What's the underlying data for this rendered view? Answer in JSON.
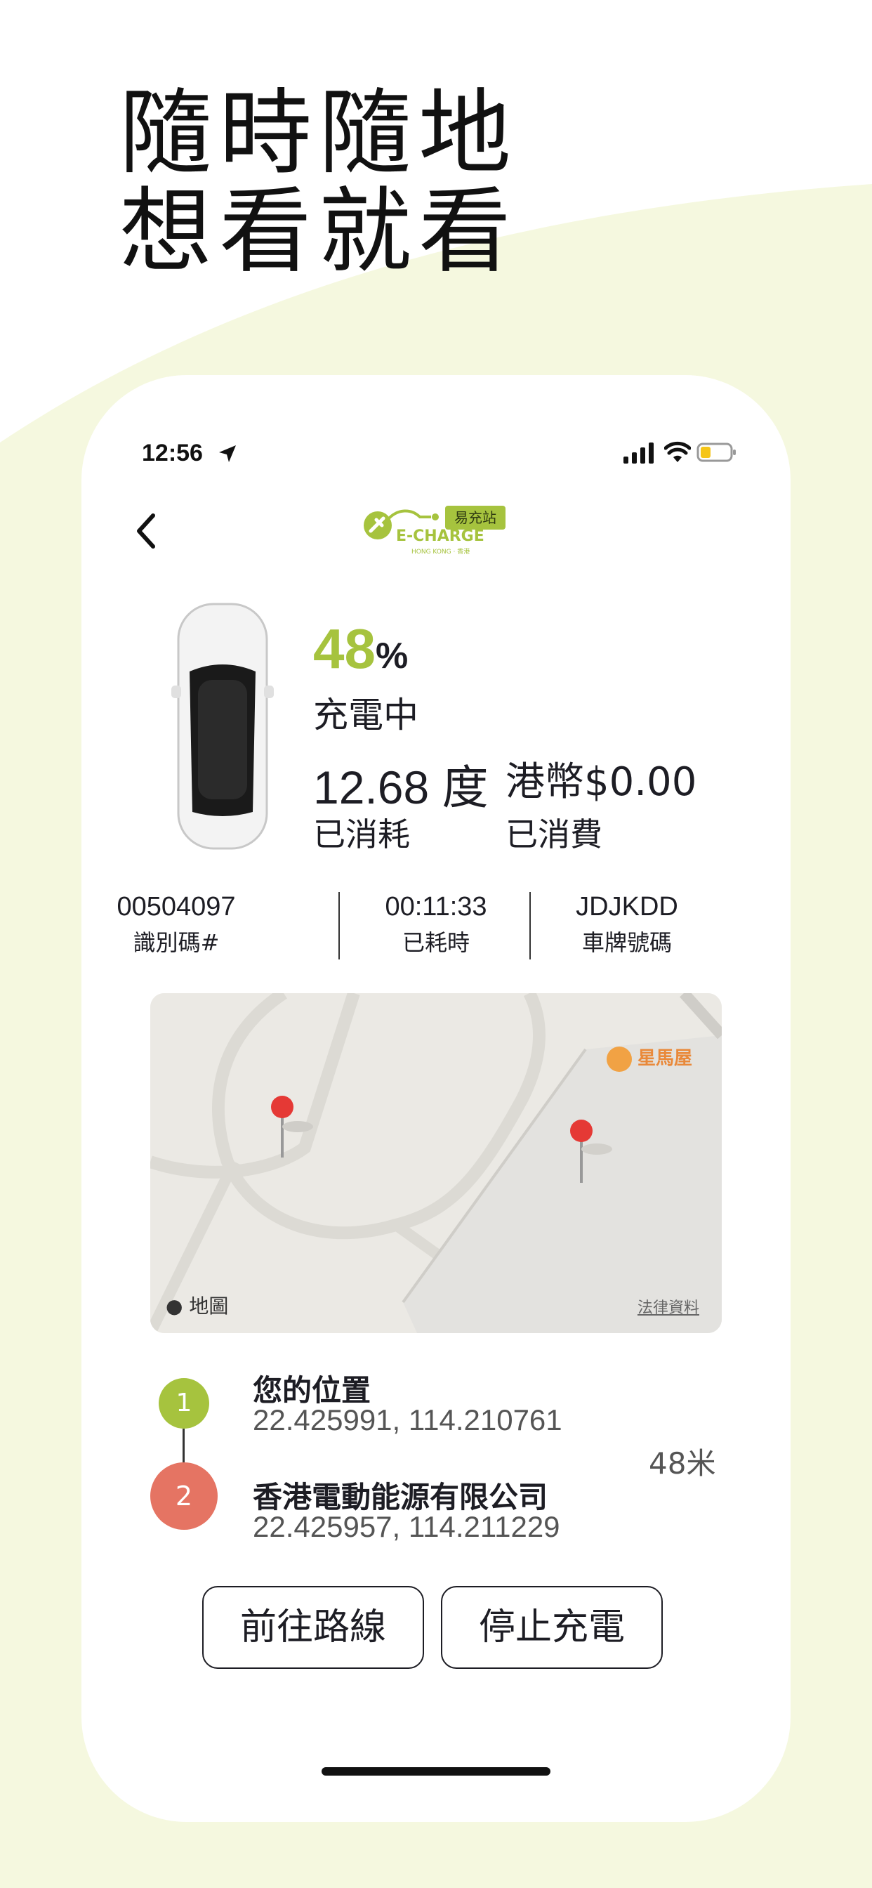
{
  "headline": {
    "line1": "隨時隨地",
    "line2": "想看就看"
  },
  "status_bar": {
    "time": "12:56"
  },
  "logo": {
    "badge": "易充站",
    "name": "E-CHARGE",
    "sub": "HONG KONG · 香港"
  },
  "charge": {
    "percent_value": "48",
    "percent_unit": "%",
    "status": "充電中",
    "energy_value": "12.68 度",
    "energy_label": "已消耗",
    "cost_value": "港幣$0.00",
    "cost_label": "已消費"
  },
  "info": [
    {
      "value": "00504097",
      "label": "識別碼#"
    },
    {
      "value": "00:11:33",
      "label": "已耗時"
    },
    {
      "value": "JDJKDD",
      "label": "車牌號碼"
    }
  ],
  "map": {
    "brand": "地圖",
    "legal": "法律資料",
    "poi": "星馬屋"
  },
  "locations": {
    "p1_index": "1",
    "p1_title": "您的位置",
    "p1_coord": "22.425991, 114.210761",
    "p2_index": "2",
    "p2_title": "香港電動能源有限公司",
    "p2_coord": "22.425957, 114.211229",
    "distance": "48米"
  },
  "buttons": {
    "route": "前往路線",
    "stop": "停止充電"
  },
  "colors": {
    "accent_green": "#a6c33e",
    "accent_red": "#e57463",
    "background_tint": "#f5f8df"
  }
}
